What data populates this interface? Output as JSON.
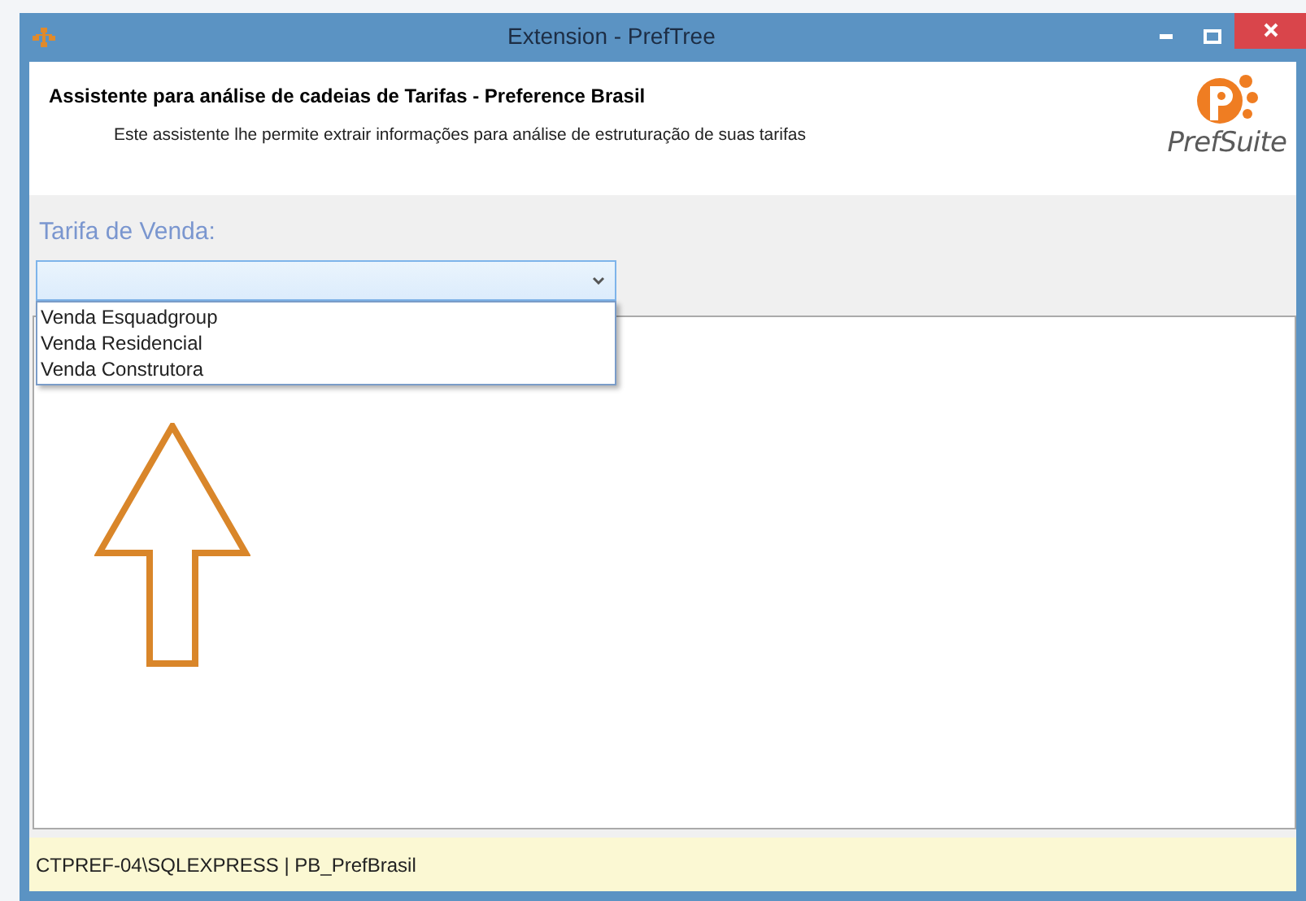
{
  "window": {
    "title": "Extension - PrefTree"
  },
  "header": {
    "title": "Assistente para análise de cadeias de Tarifas - Preference Brasil",
    "subtitle": "Este assistente lhe permite extrair informações para análise de estruturação de suas tarifas",
    "logo_text": "PrefSuite"
  },
  "form": {
    "label": "Tarifa de Venda:",
    "dropdown": {
      "expanded": true,
      "options": [
        "Venda Esquadgroup",
        "Venda Residencial",
        "Venda Construtora"
      ]
    }
  },
  "status_bar": "CTPREF-04\\SQLEXPRESS | PB_PrefBrasil"
}
